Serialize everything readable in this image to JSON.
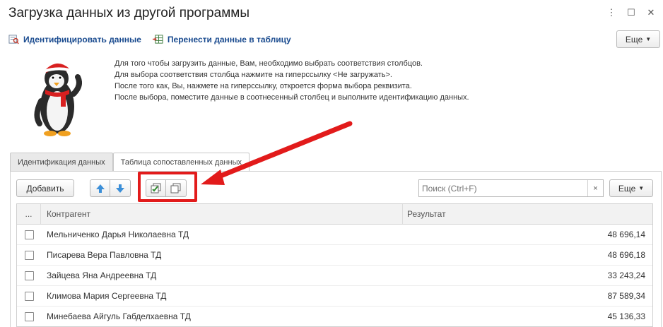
{
  "window": {
    "title": "Загрузка данных из другой программы",
    "more_icon": "kebab-icon",
    "maximize_icon": "maximize-icon",
    "close_icon": "close-icon"
  },
  "commands": {
    "identify_label": "Идентифицировать данные",
    "transfer_label": "Перенести данные в таблицу",
    "more_label": "Еще"
  },
  "info": {
    "lines": [
      "Для того чтобы загрузить данные, Вам, необходимо выбрать соответствия столбцов.",
      "Для выбора соответствия столбца нажмите на гиперссылку <Не загружать>.",
      "После того как, Вы, нажмете на гиперссылку, откроется форма выбора реквизита.",
      "После выбора, поместите данные в соотнесенный столбец и выполните идентификацию данных."
    ]
  },
  "tabs": [
    {
      "label": "Идентификация данных",
      "active": false
    },
    {
      "label": "Таблица сопоставленных данных",
      "active": true
    }
  ],
  "toolbar": {
    "add_label": "Добавить",
    "search_placeholder": "Поиск (Ctrl+F)",
    "clear_label": "×",
    "more_label": "Еще"
  },
  "table": {
    "columns": {
      "cb": "...",
      "name": "Контрагент",
      "result": "Результат"
    },
    "rows": [
      {
        "name": "Мельниченко Дарья Николаевна ТД",
        "result": "48 696,14"
      },
      {
        "name": "Писарева Вера Павловна ТД",
        "result": "48 696,18"
      },
      {
        "name": "Зайцева Яна Андреевна ТД",
        "result": "33 243,24"
      },
      {
        "name": "Климова Мария Сергеевна ТД",
        "result": "87 589,34"
      },
      {
        "name": "Минебаева Айгуль Габделхаевна ТД",
        "result": "45 136,33"
      }
    ]
  },
  "colors": {
    "link": "#1a4b8f",
    "highlight": "#e21b1b",
    "arrow_button": "#3c8fd8"
  }
}
